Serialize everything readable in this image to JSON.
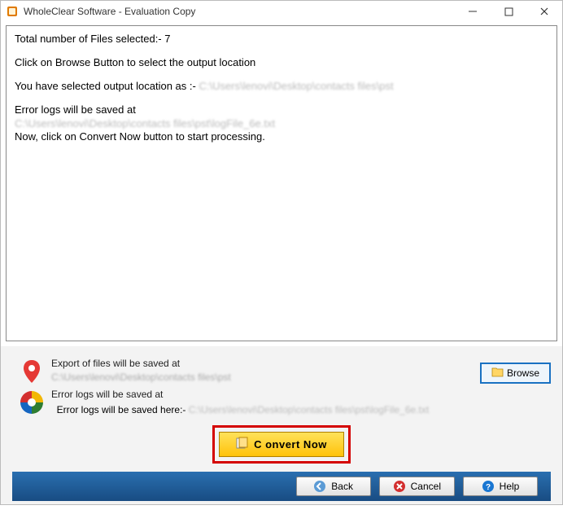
{
  "titlebar": {
    "title": "WholeClear Software - Evaluation Copy"
  },
  "log": {
    "line1": "Total number of Files selected:- 7",
    "line2": "Click on Browse Button to select the output location",
    "line3_prefix": "You have selected output location as :- ",
    "line3_path": "C:\\Users\\lenovi\\Desktop\\contacts files\\pst",
    "line4": "Error logs will be saved at",
    "line4_path": "C:\\Users\\lenovi\\Desktop\\contacts files\\pst\\logFile_6e.txt",
    "line5": "Now, click on Convert Now button to start processing."
  },
  "export": {
    "title": "Export of files will be saved at",
    "path": "C:\\Users\\lenovi\\Desktop\\contacts files\\pst",
    "browse_label": "Browse"
  },
  "errors": {
    "title": "Error logs will be saved at",
    "sub_prefix": "Error logs will be saved here:- ",
    "sub_path": "C:\\Users\\lenovi\\Desktop\\contacts files\\pst\\logFile_6e.txt"
  },
  "buttons": {
    "convert": "C onvert Now",
    "back": "Back",
    "cancel": "Cancel",
    "help": "Help"
  }
}
